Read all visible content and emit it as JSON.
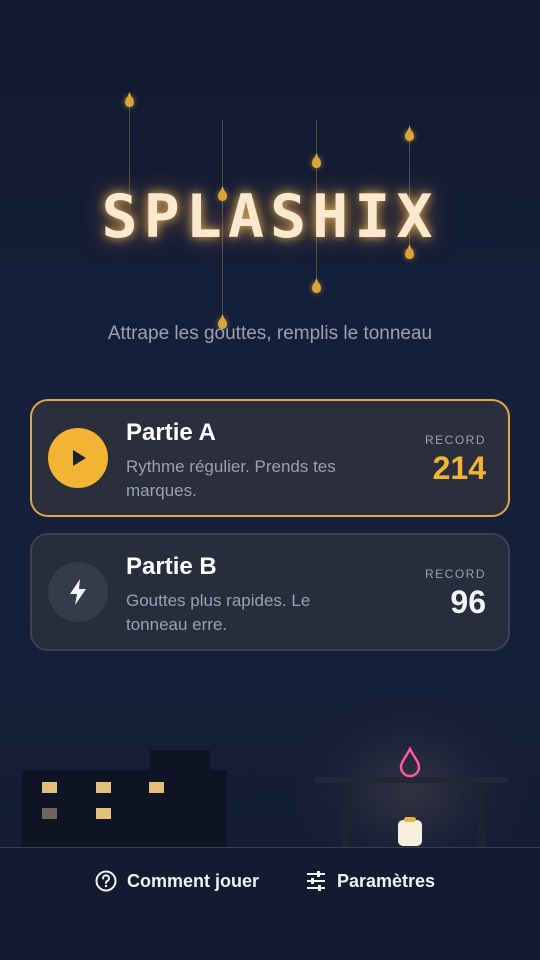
{
  "app": {
    "title": "SPLASHIX",
    "subtitle": "Attrape les gouttes, remplis le tonneau"
  },
  "modes": [
    {
      "name": "Partie A",
      "description": "Rythme régulier. Prends tes marques.",
      "record_label": "RECORD",
      "record_value": "214",
      "icon": "play-icon",
      "selected": true
    },
    {
      "name": "Partie B",
      "description": "Gouttes plus rapides. Le tonneau erre.",
      "record_label": "RECORD",
      "record_value": "96",
      "icon": "lightning-icon",
      "selected": false
    }
  ],
  "footer": {
    "how_to_play": "Comment jouer",
    "how_to_play_icon": "help-circle-icon",
    "settings": "Paramètres",
    "settings_icon": "sliders-icon"
  },
  "colors": {
    "accent": "#f3b333",
    "background": "#141c33",
    "card": "#272d3c",
    "drop_neon": "#ff5aa0"
  }
}
